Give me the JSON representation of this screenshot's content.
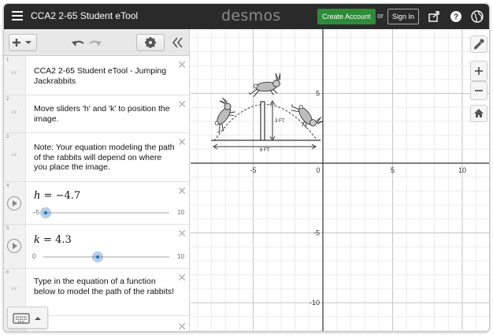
{
  "header": {
    "title": "CCA2 2-65 Student eTool",
    "logo": "desmos",
    "create_account": "Create Account",
    "or": "or",
    "sign_in": "Sign In"
  },
  "expressions": [
    {
      "num": "1",
      "type": "note",
      "text": "CCA2 2-65 Student eTool - Jumping Jackrabbits"
    },
    {
      "num": "2",
      "type": "note",
      "text": "Move sliders 'h' and 'k' to position the image."
    },
    {
      "num": "3",
      "type": "note",
      "text": "Note: Your equation modeling the path of the rabbits will depend on where you place the image."
    },
    {
      "num": "4",
      "type": "slider",
      "var": "h",
      "eq": "=",
      "value": "−4.7",
      "min": "−5",
      "max": "10",
      "fraction": 0.02
    },
    {
      "num": "5",
      "type": "slider",
      "var": "k",
      "eq": "=",
      "value": "4.3",
      "min": "0",
      "max": "10",
      "fraction": 0.43
    },
    {
      "num": "6",
      "type": "note",
      "text": "Type in the equation of a function below to model the path of the rabbits!"
    }
  ],
  "graph": {
    "x_ticks": [
      "-5",
      "0",
      "5",
      "10"
    ],
    "y_ticks": [
      "5",
      "-5",
      "-10"
    ],
    "image_labels": {
      "height": "3 FT",
      "width": "8 FT"
    }
  },
  "icons": {
    "menu": "hamburger-icon",
    "share": "share-icon",
    "help": "help-icon",
    "language": "globe-icon",
    "add": "plus-icon",
    "undo": "undo-icon",
    "redo": "redo-icon",
    "settings": "gear-icon",
    "collapse": "double-chevron-left-icon",
    "wrench": "wrench-icon",
    "zoom_in": "zoom-in-icon",
    "zoom_out": "zoom-out-icon",
    "home": "home-icon",
    "keyboard": "keyboard-icon"
  },
  "colors": {
    "topbar": "#2a2a2a",
    "create_account": "#2f8a3c",
    "slider": "#2d70b3"
  }
}
